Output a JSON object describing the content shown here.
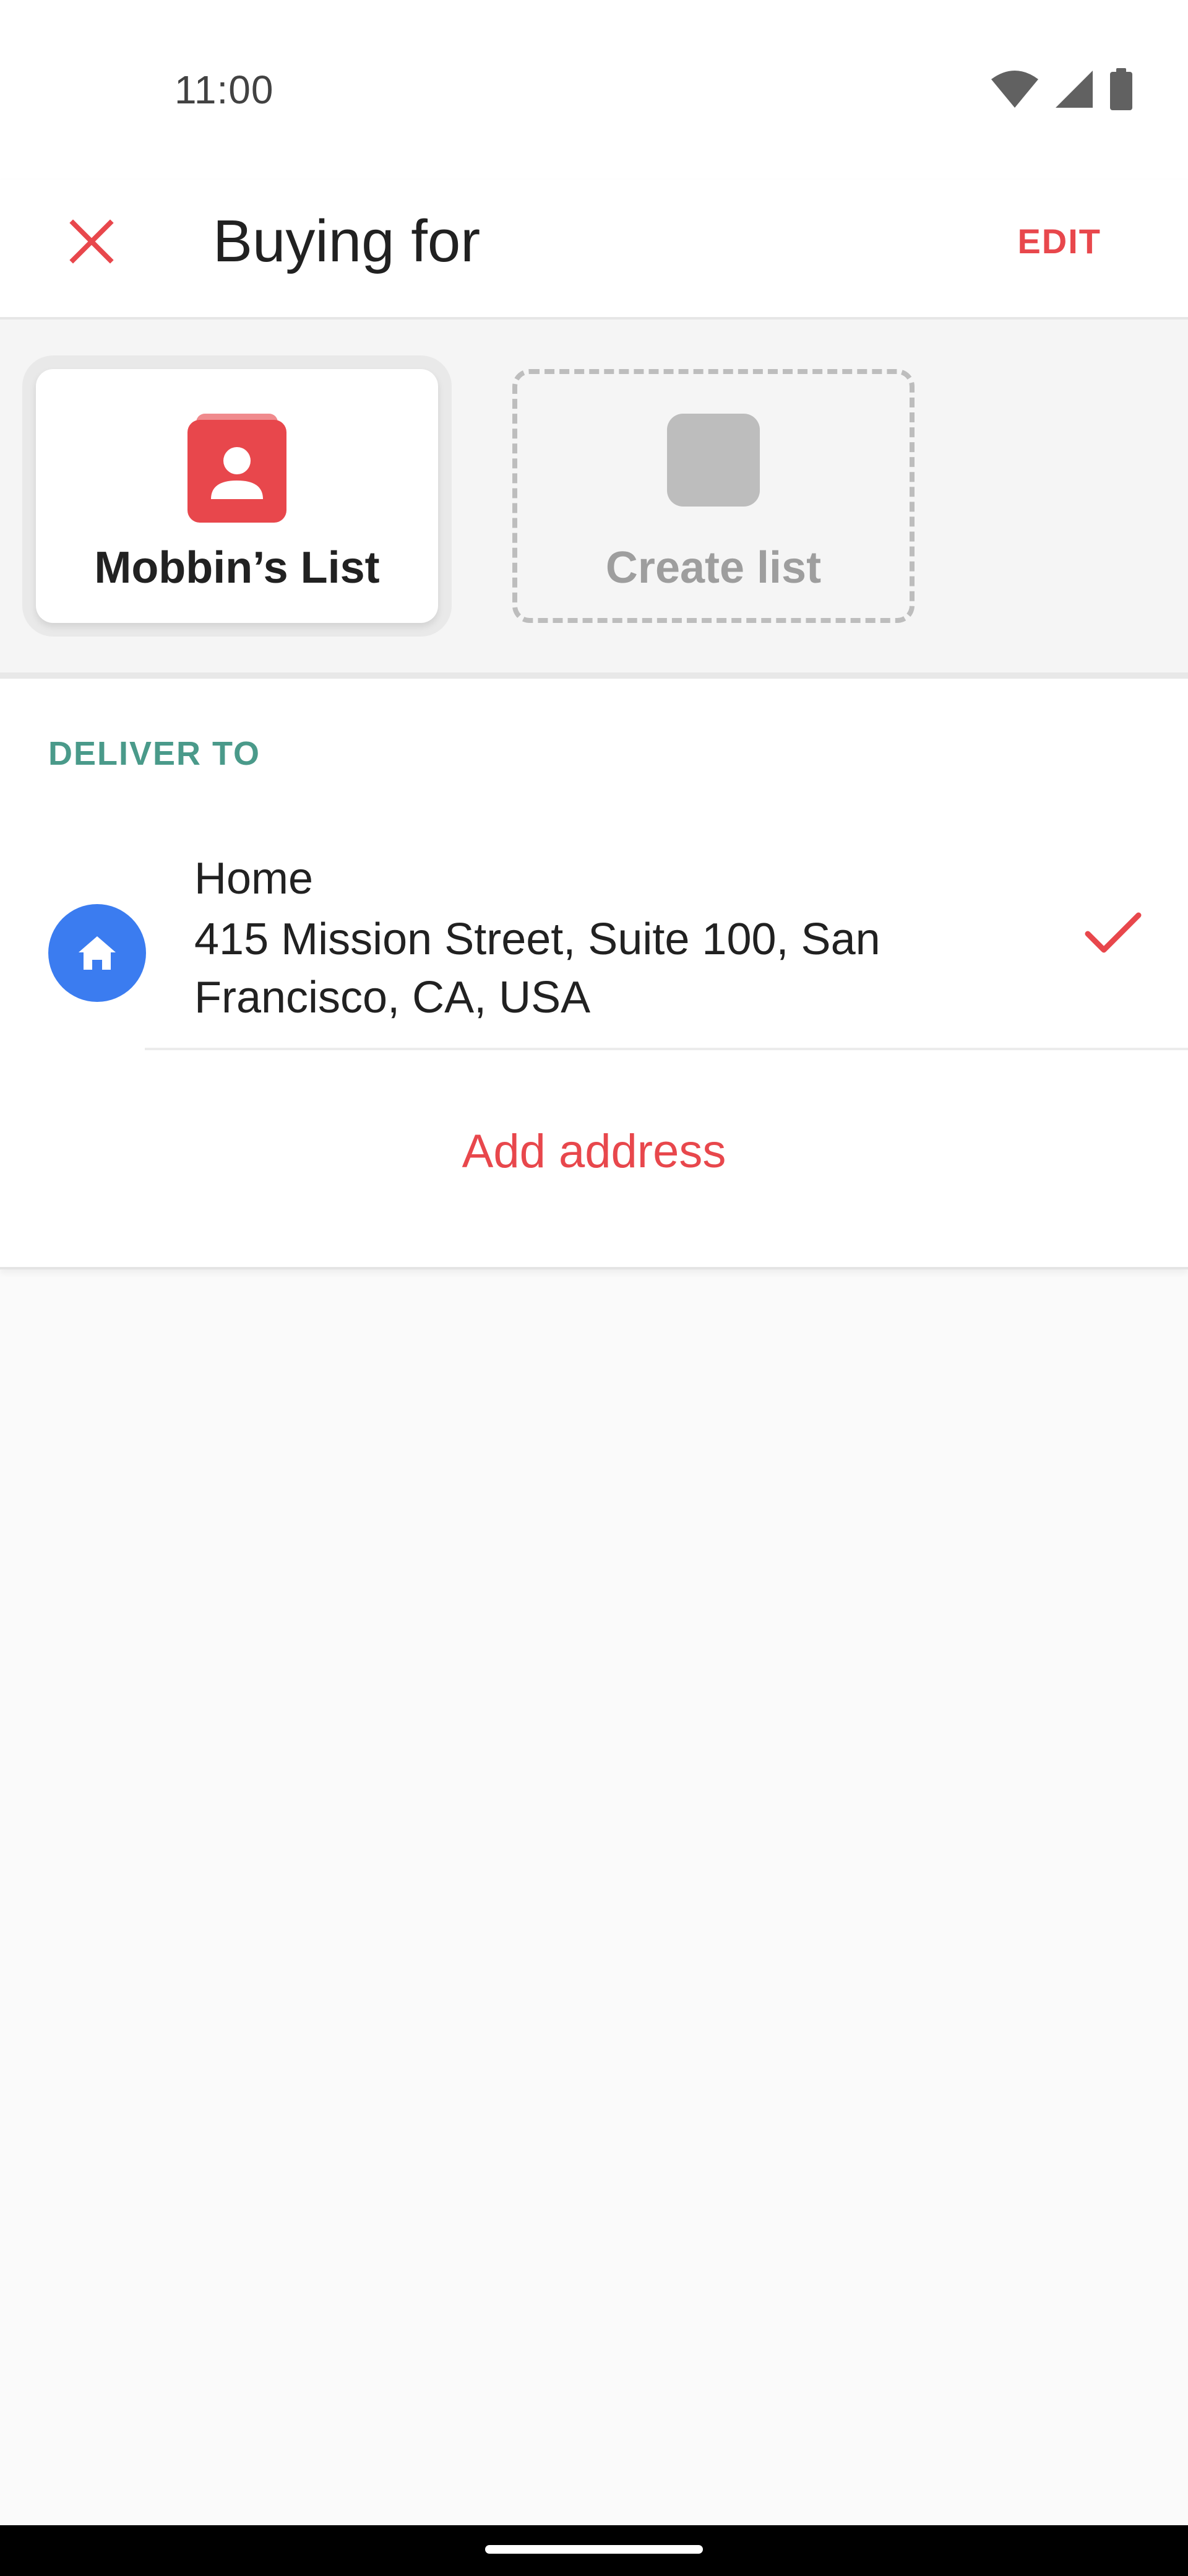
{
  "status_bar": {
    "time": "11:00",
    "icons": [
      "wifi-icon",
      "cellular-signal-icon",
      "battery-icon"
    ]
  },
  "app_bar": {
    "close_icon": "close-icon",
    "title": "Buying for",
    "edit_label": "EDIT"
  },
  "lists": [
    {
      "label": "Mobbin’s List",
      "icon": "contact-book-icon",
      "selected": true
    },
    {
      "label": "Create list",
      "icon": "placeholder-square-icon",
      "selected": false
    }
  ],
  "deliver": {
    "heading": "DELIVER TO",
    "address": {
      "label": "Home",
      "line": "415 Mission Street, Suite 100, San Francisco, CA, USA",
      "icon": "home-icon",
      "selected_icon": "checkmark-icon"
    },
    "add_address_label": "Add address"
  },
  "colors": {
    "accent_red": "#e8474c",
    "heading_teal": "#4a9a8a",
    "home_blue": "#3b7cf0",
    "placeholder_gray": "#bdbdbd"
  }
}
